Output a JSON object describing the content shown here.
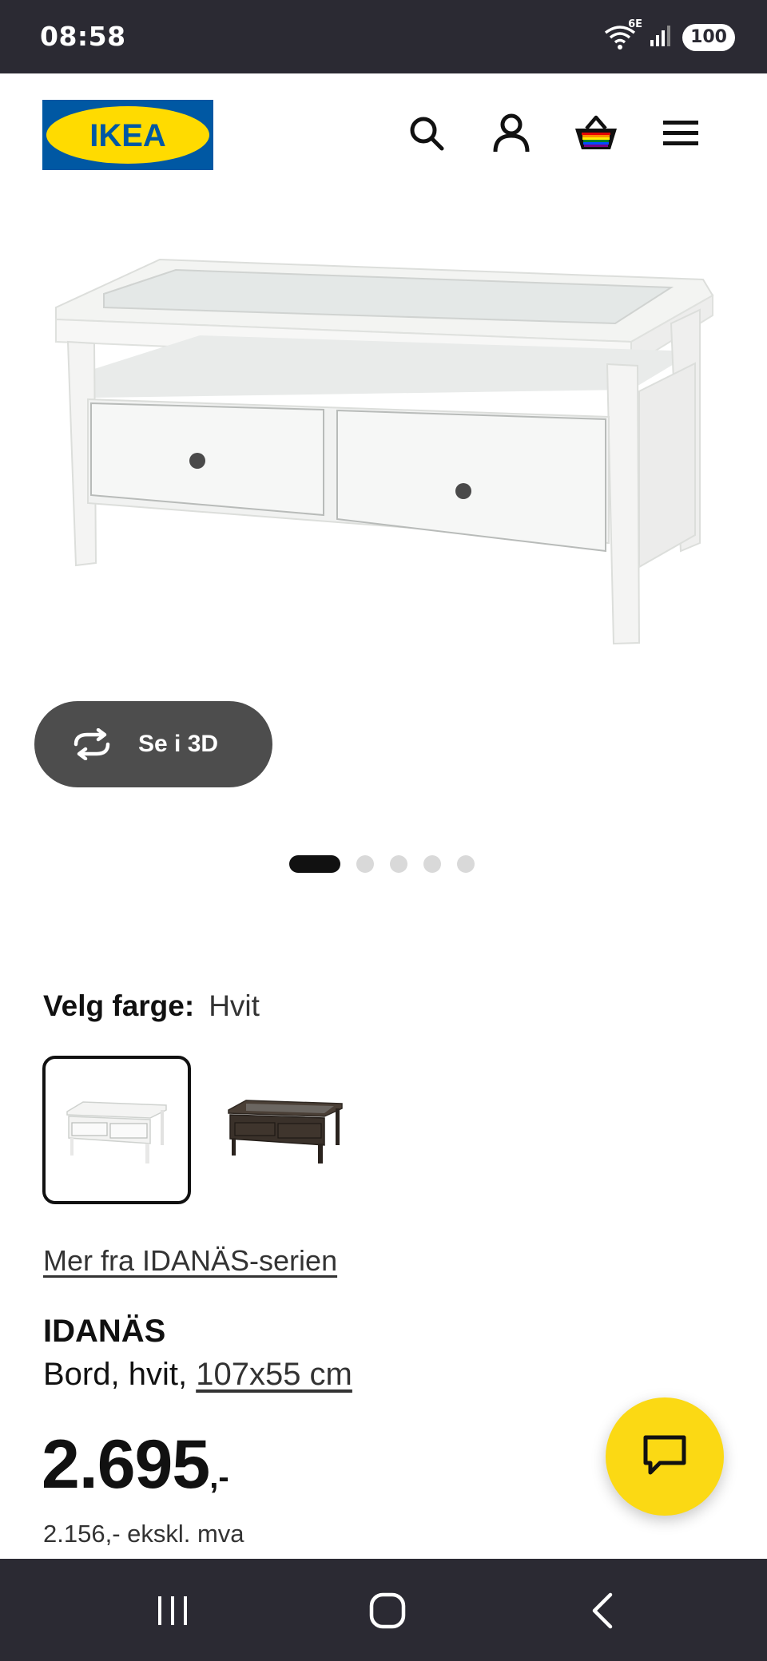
{
  "status_bar": {
    "time": "08:58",
    "network": "6E",
    "battery": "100"
  },
  "header": {
    "logo_text": "IKEA",
    "icons": [
      "search-icon",
      "account-icon",
      "basket-icon",
      "menu-icon"
    ]
  },
  "gallery": {
    "view_3d_label": "Se i 3D",
    "total_images": 5,
    "active_index": 0
  },
  "color_select": {
    "label": "Velg farge:",
    "value": "Hvit",
    "options": [
      "Hvit",
      "Mørk brun"
    ]
  },
  "series_link": "Mer fra IDANÄS-serien",
  "product": {
    "name": "IDANÄS",
    "description": "Bord, hvit,",
    "size": "107x55 cm"
  },
  "price": {
    "amount": "2.695",
    "suffix": ",-",
    "ex_vat": "2.156,- ekskl. mva"
  },
  "colors": {
    "brand_blue": "#0058a3",
    "brand_yellow": "#ffdb00",
    "chat_fab": "#fbd914",
    "system_bar": "#2b2a33"
  }
}
